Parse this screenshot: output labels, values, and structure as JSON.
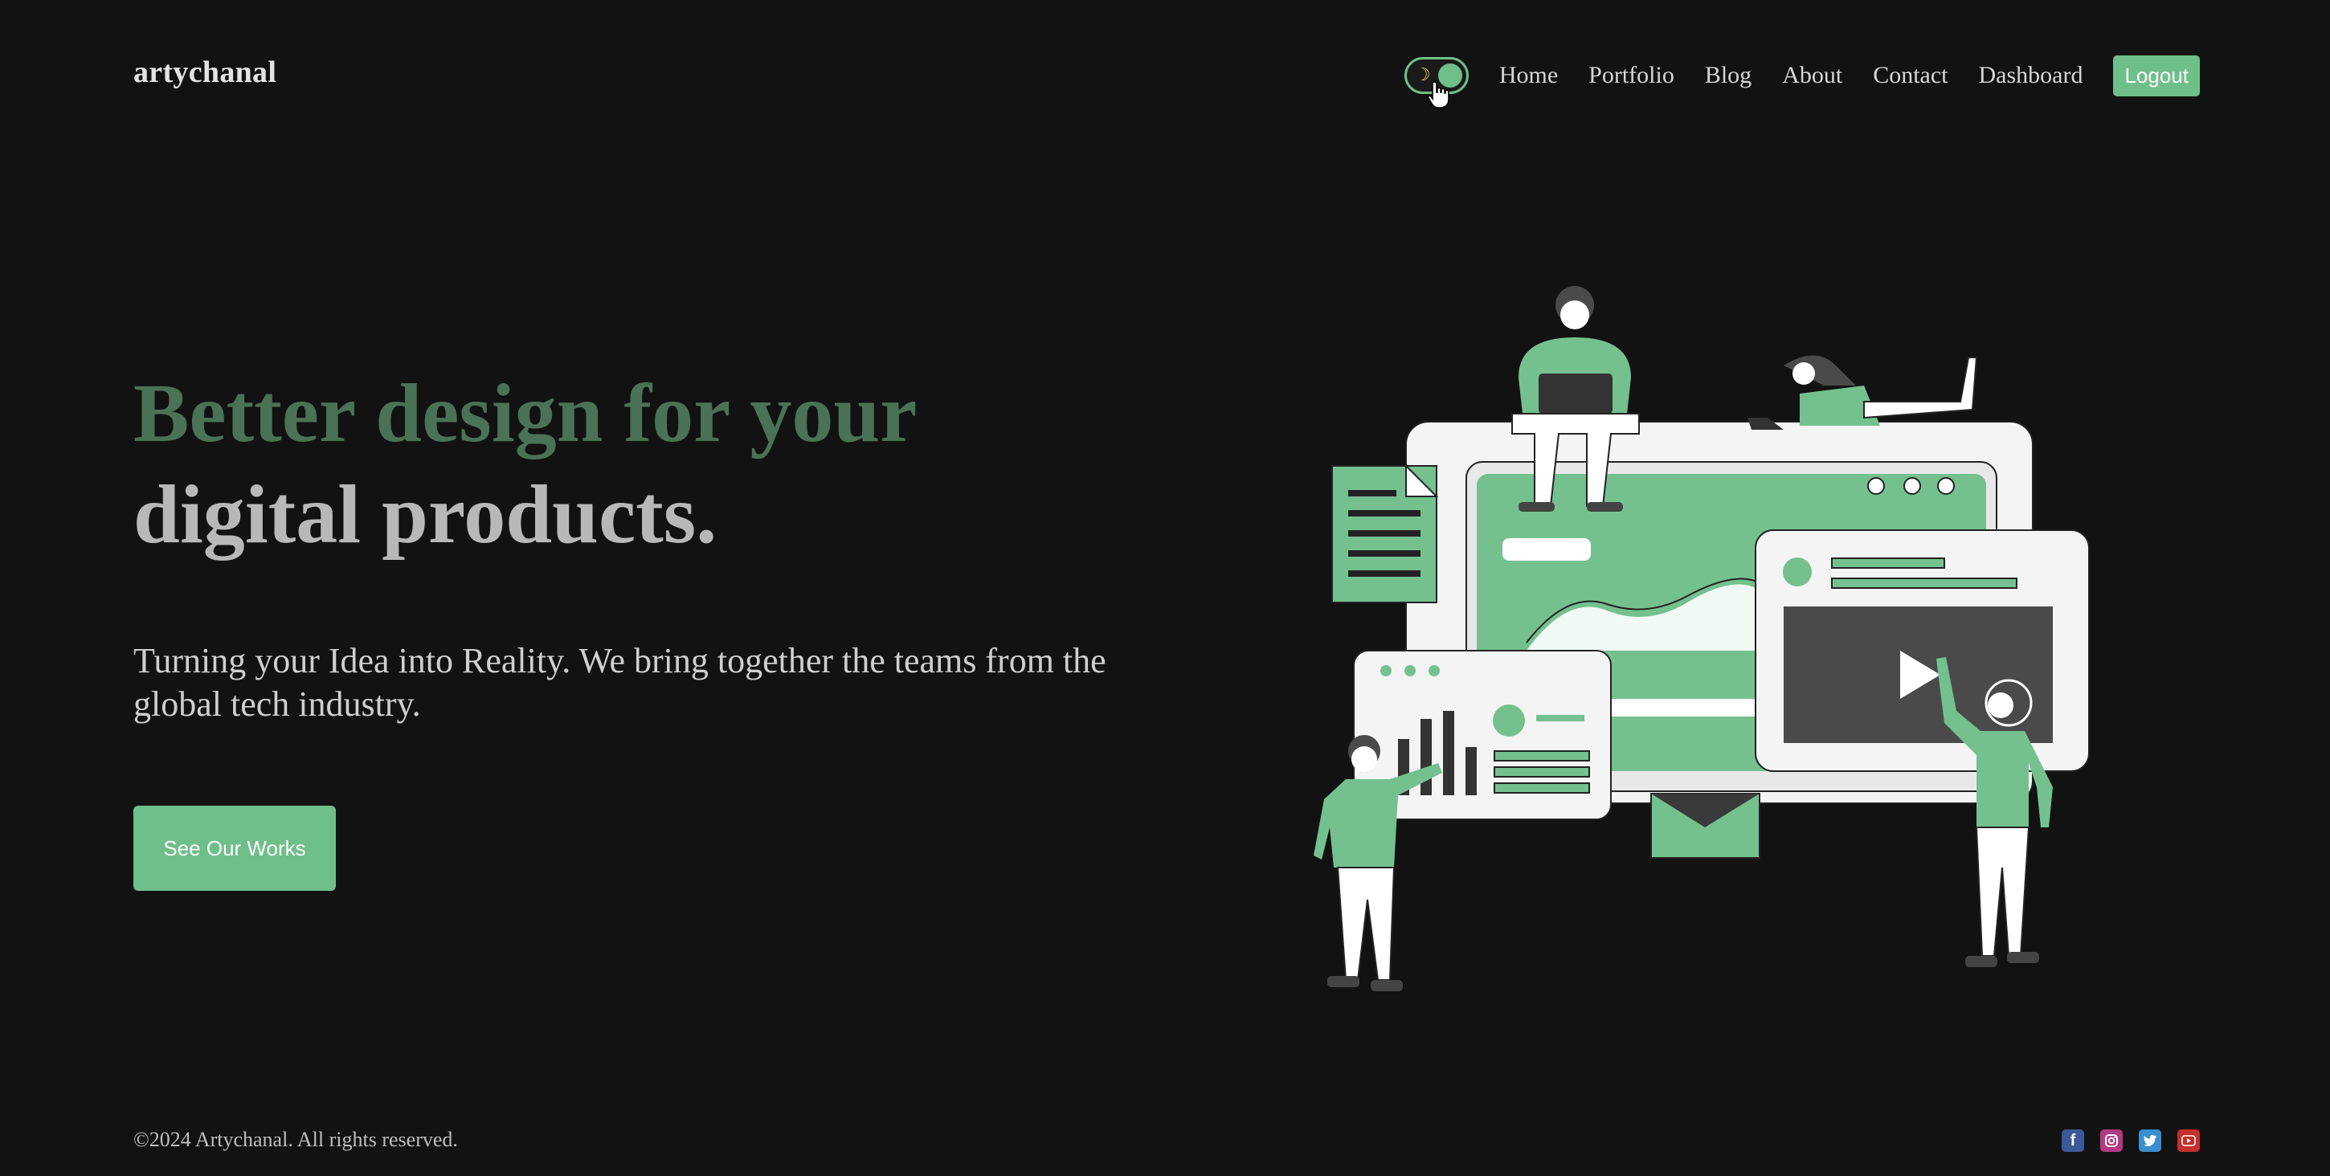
{
  "brand": {
    "name": "artychanal"
  },
  "theme_toggle": {
    "icon": "moon-icon",
    "state": "dark",
    "accent": "#6fbf8a"
  },
  "nav": {
    "links": [
      "Home",
      "Portfolio",
      "Blog",
      "About",
      "Contact",
      "Dashboard"
    ],
    "logout_label": "Logout"
  },
  "hero": {
    "title_line1": "Better design for your",
    "title_line2": "digital products.",
    "subtitle": "Turning your Idea into Reality. We bring together the teams from the global tech industry.",
    "cta_label": "See Our Works"
  },
  "footer": {
    "copyright": "©2024 Artychanal. All rights reserved.",
    "socials": [
      "facebook-icon",
      "instagram-icon",
      "twitter-icon",
      "youtube-icon"
    ]
  },
  "colors": {
    "background": "#121212",
    "accent": "#6fbf8a",
    "title_accent": "#4a7256",
    "text": "#d6d6d6"
  }
}
